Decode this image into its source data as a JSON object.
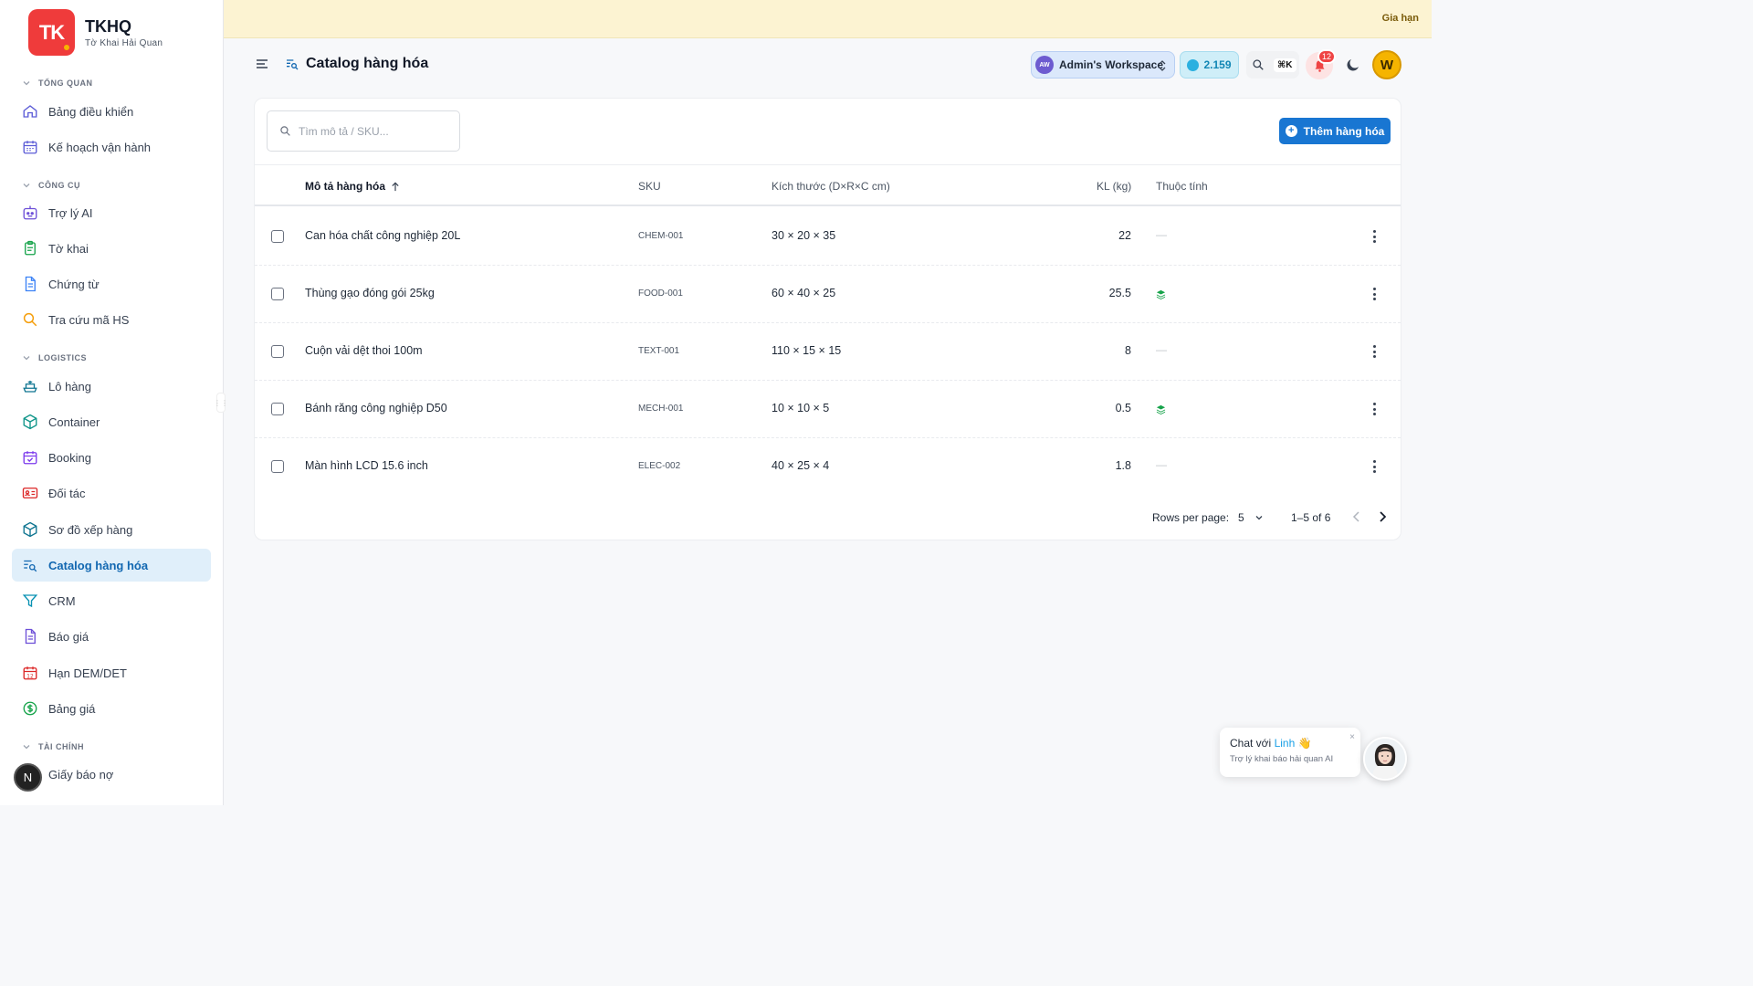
{
  "brand": {
    "logo_text": "TK",
    "name": "TKHQ",
    "subtitle": "Tờ Khai Hải Quan"
  },
  "banner": {
    "link": "Gia hạn"
  },
  "sidebar": {
    "sections": [
      {
        "title": "TỔNG QUAN"
      },
      {
        "title": "CÔNG CỤ"
      },
      {
        "title": "LOGISTICS"
      },
      {
        "title": "TÀI CHÍNH"
      }
    ],
    "items": [
      {
        "label": "Bảng điều khiển",
        "icon": "home-icon"
      },
      {
        "label": "Kế hoạch vận hành",
        "icon": "calendar-icon"
      },
      {
        "label": "Trợ lý AI",
        "icon": "bot-icon"
      },
      {
        "label": "Tờ khai",
        "icon": "clipboard-icon"
      },
      {
        "label": "Chứng từ",
        "icon": "document-icon"
      },
      {
        "label": "Tra cứu mã HS",
        "icon": "search-icon"
      },
      {
        "label": "Lô hàng",
        "icon": "ship-icon"
      },
      {
        "label": "Container",
        "icon": "box-icon"
      },
      {
        "label": "Booking",
        "icon": "calendar-check-icon"
      },
      {
        "label": "Đối tác",
        "icon": "id-card-icon"
      },
      {
        "label": "Sơ đồ xếp hàng",
        "icon": "cube-icon"
      },
      {
        "label": "Catalog hàng hóa",
        "icon": "list-search-icon",
        "active": true
      },
      {
        "label": "CRM",
        "icon": "funnel-icon"
      },
      {
        "label": "Báo giá",
        "icon": "file-text-icon"
      },
      {
        "label": "Hạn DEM/DET",
        "icon": "calendar-12-icon",
        "calendar_digits": "12"
      },
      {
        "label": "Bảng giá",
        "icon": "dollar-circle-icon"
      },
      {
        "label": "Giấy báo nợ",
        "icon": "receipt-icon"
      }
    ],
    "user_chip": "N"
  },
  "header": {
    "title": "Catalog hàng hóa",
    "workspace": {
      "initials": "AW",
      "name": "Admin's Workspace"
    },
    "credits": "2.159",
    "shortcut": "⌘K",
    "notifications": "12",
    "avatar": "W"
  },
  "toolbar": {
    "search_placeholder": "Tìm mô tả / SKU...",
    "add_label": "Thêm hàng hóa"
  },
  "table": {
    "columns": [
      "Mô tả hàng hóa",
      "SKU",
      "Kích thước (D×R×C cm)",
      "KL (kg)",
      "Thuộc tính"
    ],
    "rows": [
      {
        "desc": "Can hóa chất công nghiệp 20L",
        "sku": "CHEM-001",
        "dims": "30 × 20 × 35",
        "kl": "22",
        "attr": "—"
      },
      {
        "desc": "Thùng gạo đóng gói 25kg",
        "sku": "FOOD-001",
        "dims": "60 × 40 × 25",
        "kl": "25.5",
        "attr": "stack-icon"
      },
      {
        "desc": "Cuộn vải dệt thoi 100m",
        "sku": "TEXT-001",
        "dims": "110 × 15 × 15",
        "kl": "8",
        "attr": "—"
      },
      {
        "desc": "Bánh răng công nghiệp D50",
        "sku": "MECH-001",
        "dims": "10 × 10 × 5",
        "kl": "0.5",
        "attr": "stack-icon"
      },
      {
        "desc": "Màn hình LCD 15.6 inch",
        "sku": "ELEC-002",
        "dims": "40 × 25 × 4",
        "kl": "1.8",
        "attr": "—"
      }
    ]
  },
  "pagination": {
    "rows_label": "Rows per page:",
    "rows_value": "5",
    "range": "1–5 of 6"
  },
  "chat": {
    "title_prefix": "Chat với",
    "name": "Linh",
    "emoji": "👋",
    "subtitle": "Trợ lý khai báo hải quan AI",
    "close": "×"
  },
  "colors": {
    "accent": "#1976d2",
    "active_nav_bg": "#e0effa",
    "banner_bg": "#fcf3d2",
    "logo_red": "#ef3b3b",
    "stack_green": "#16a34a"
  }
}
